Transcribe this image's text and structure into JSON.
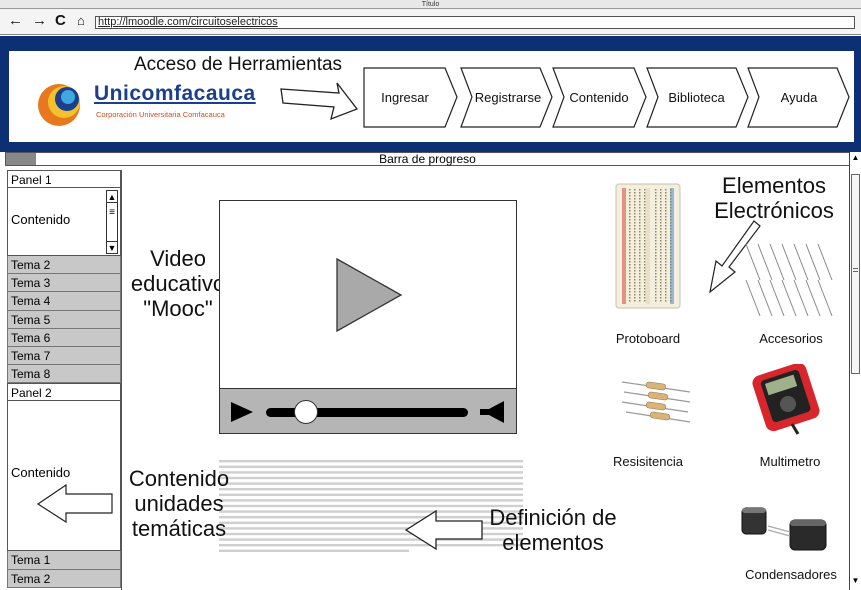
{
  "window": {
    "title": "Título"
  },
  "browser": {
    "back_icon": "arrow-left-icon",
    "forward_icon": "arrow-right-icon",
    "reload_icon": "reload-icon",
    "home_icon": "home-icon",
    "url": "http://lmoodle.com/circuitoselectricos"
  },
  "header": {
    "brand_name": "Unicomfacauca",
    "brand_subtitle": "Corporación Universitaria Comfacauca",
    "tools_annotation": "Acceso de Herramientas",
    "nav": [
      "Ingresar",
      "Registrarse",
      "Contenido",
      "Biblioteca",
      "Ayuda"
    ],
    "colors": {
      "frame": "#0d2f74",
      "brand_blue": "#1b3e8f",
      "brand_orange": "#d54b1c"
    }
  },
  "progress": {
    "label": "Barra de progreso",
    "value": 0.035
  },
  "sidebar": {
    "panel1": {
      "title": "Panel 1",
      "content": "Contenido",
      "temas": [
        "Tema 2",
        "Tema 3",
        "Tema 4",
        "Tema 5",
        "Tema 6",
        "Tema 7",
        "Tema 8"
      ]
    },
    "panel2": {
      "title": "Panel 2",
      "content": "Contenido",
      "temas": [
        "Tema 1",
        "Tema 2"
      ]
    }
  },
  "main": {
    "video_annotation": [
      "Video",
      "educativo",
      "\"Mooc\""
    ],
    "units_annotation": [
      "Contenido",
      "unidades",
      "temáticas"
    ],
    "definitions_annotation": [
      "Definición de",
      "elementos"
    ],
    "video": {
      "playhead_fraction": 0.2
    }
  },
  "elements": {
    "heading": [
      "Elementos",
      "Electrónicos"
    ],
    "items": [
      "Protoboard",
      "Accesorios",
      "Resisitencia",
      "Multimetro",
      "Condensadores"
    ]
  }
}
